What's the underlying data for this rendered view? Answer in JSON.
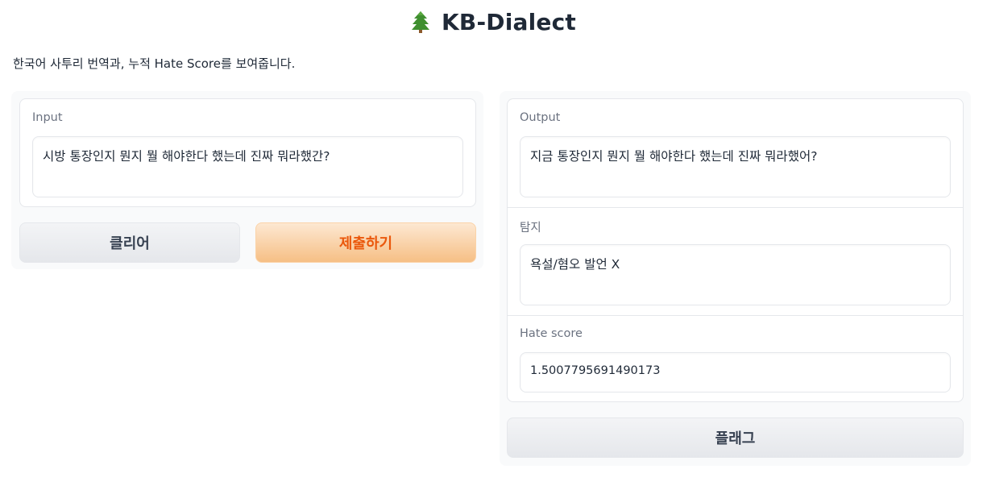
{
  "header": {
    "icon": "tree-icon",
    "title": "KB-Dialect"
  },
  "description": "한국어 사투리 번역과, 누적 Hate Score를 보여줍니다.",
  "input": {
    "label": "Input",
    "value": "시방 통장인지 뭔지 뭘 해야한다 했는데 진짜 뭐라했간?"
  },
  "buttons": {
    "clear": "클리어",
    "submit": "제출하기",
    "flag": "플래그"
  },
  "output": {
    "label": "Output",
    "value": "지금 통장인지 뭔지 뭘 해야한다 했는데 진짜 뭐라했어?"
  },
  "detection": {
    "label": "탐지",
    "value": "욕설/혐오 발언 X"
  },
  "hate_score": {
    "label": "Hate score",
    "value": "1.5007795691490173"
  },
  "colors": {
    "primary_text": "#ea580c",
    "primary_bg": "#f6bf85",
    "panel_bg": "#f9fafb",
    "border": "#e5e7eb"
  }
}
